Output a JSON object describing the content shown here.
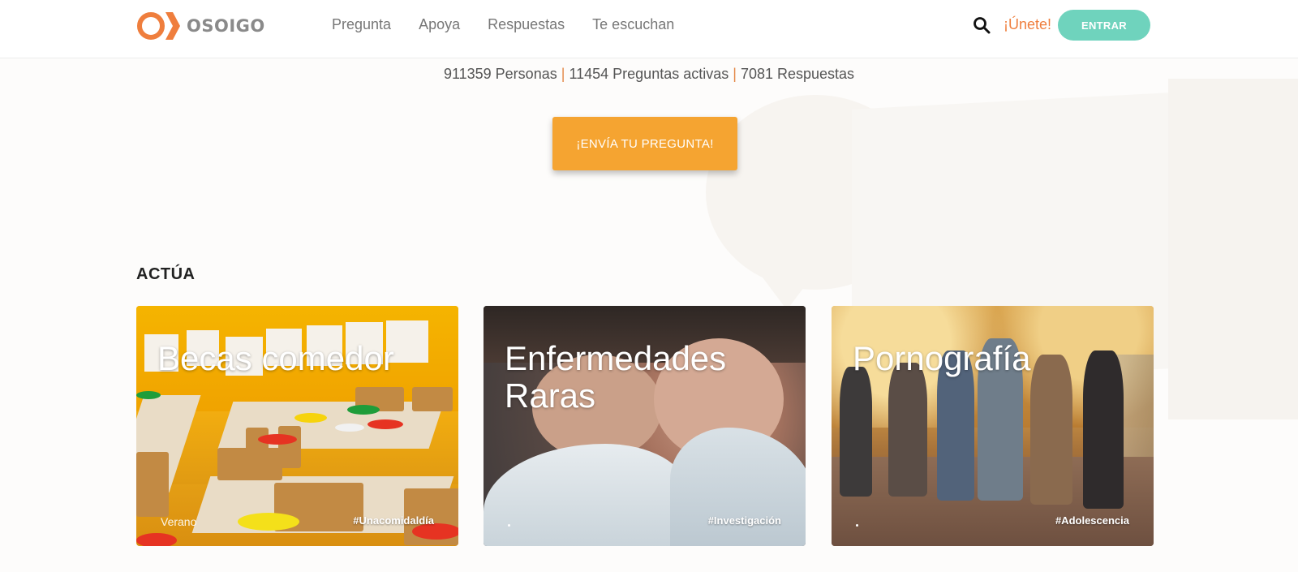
{
  "header": {
    "logo_text": "OSOIGO",
    "nav": [
      "Pregunta",
      "Apoya",
      "Respuestas",
      "Te escuchan"
    ],
    "join_label": "¡Únete!",
    "enter_label": "ENTRAR",
    "icons": {
      "search": "search-icon"
    }
  },
  "stats": {
    "people": "911359 Personas",
    "questions": "11454 Preguntas activas",
    "answers": "7081 Respuestas",
    "separator": "|"
  },
  "cta": {
    "label": "¡ENVÍA TU PREGUNTA!"
  },
  "section": {
    "title": "ACTÚA"
  },
  "cards": [
    {
      "title": "Becas comedor",
      "tag_left": "Verano",
      "tag_right": "#Unacomidaldía"
    },
    {
      "title": "Enfermedades Raras",
      "tag_left": "",
      "tag_right": "#Investigación"
    },
    {
      "title": "Pornografía",
      "tag_left": "",
      "tag_right": "#Adolescencia"
    }
  ],
  "colors": {
    "accent_orange": "#ef7e3d",
    "cta_orange": "#f5a431",
    "teal": "#6fd3bd"
  }
}
